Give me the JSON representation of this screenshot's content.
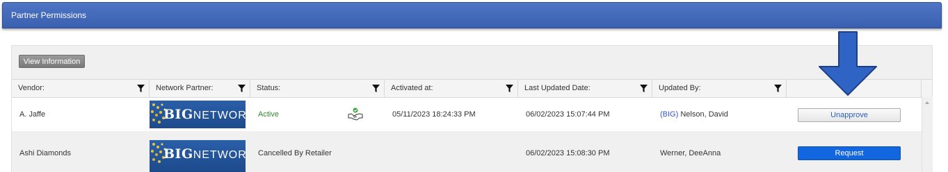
{
  "panel": {
    "title": "Partner Permissions"
  },
  "toolbar": {
    "view_info_label": "View Information"
  },
  "columns": [
    {
      "label": "Vendor:"
    },
    {
      "label": "Network Partner:"
    },
    {
      "label": "Status:"
    },
    {
      "label": "Activated at:"
    },
    {
      "label": "Last Updated Date:"
    },
    {
      "label": "Updated By:"
    }
  ],
  "logo": {
    "big": "BIG",
    "network": "NETWORK",
    "icon": "big-network-logo"
  },
  "rows": [
    {
      "vendor": "A. Jaffe",
      "status": "Active",
      "status_color": "#2e8b2e",
      "status_icon": "handshake-check-icon",
      "activated_at": "05/11/2023 18:24:33 PM",
      "last_updated": "06/02/2023 15:07:44 PM",
      "updated_by_prefix": "(BIG)",
      "updated_by_name": " Nelson, David",
      "action": "Unapprove"
    },
    {
      "vendor": "Ashi Diamonds",
      "status": "Cancelled By Retailer",
      "activated_at": "",
      "last_updated": "06/02/2023 15:08:30 PM",
      "updated_by_prefix": "",
      "updated_by_name": "Werner, DeeAnna",
      "action": "Request"
    }
  ],
  "colors": {
    "header_blue": "#3a5fb0",
    "prefix_blue": "#3355cc",
    "request_blue": "#1266e0",
    "arrow_blue": "#2f63c4"
  }
}
